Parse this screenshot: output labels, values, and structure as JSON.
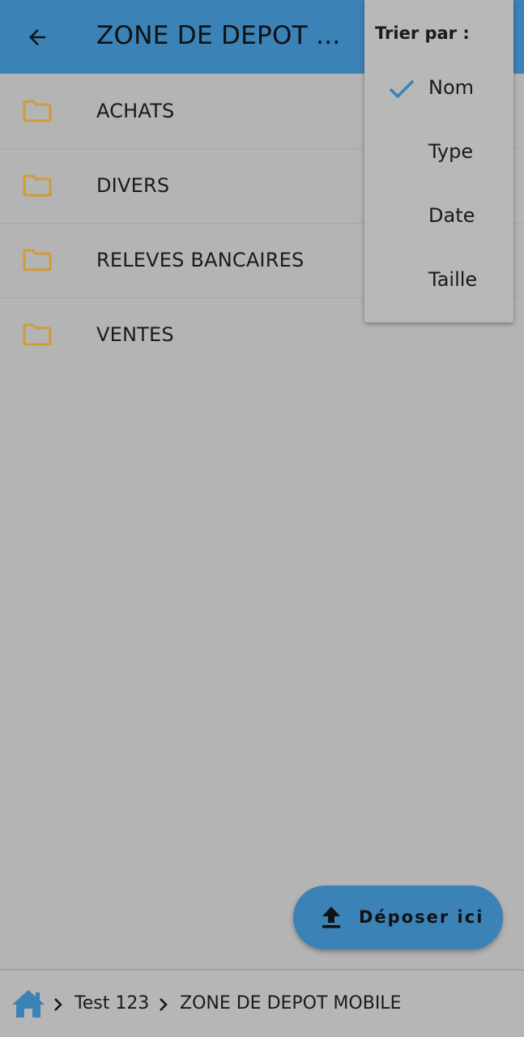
{
  "appbar": {
    "title": "ZONE DE DEPOT ..."
  },
  "folders": [
    {
      "label": "ACHATS",
      "icon": "folder-icon"
    },
    {
      "label": "DIVERS",
      "icon": "folder-icon"
    },
    {
      "label": "RELEVES BANCAIRES",
      "icon": "folder-icon"
    },
    {
      "label": "VENTES",
      "icon": "folder-icon"
    }
  ],
  "sort_menu": {
    "title": "Trier par :",
    "options": [
      {
        "label": "Nom",
        "selected": true
      },
      {
        "label": "Type",
        "selected": false
      },
      {
        "label": "Date",
        "selected": false
      },
      {
        "label": "Taille",
        "selected": false
      }
    ]
  },
  "fab": {
    "label": "Déposer ici",
    "icon": "upload-icon"
  },
  "breadcrumb": {
    "home_icon": "home-icon",
    "items": [
      "Test 123",
      "ZONE DE DEPOT MOBILE"
    ]
  },
  "colors": {
    "primary": "#3b82b6",
    "folder": "#d39a3a",
    "background": "#b4b4b4",
    "check": "#3b82b6"
  }
}
